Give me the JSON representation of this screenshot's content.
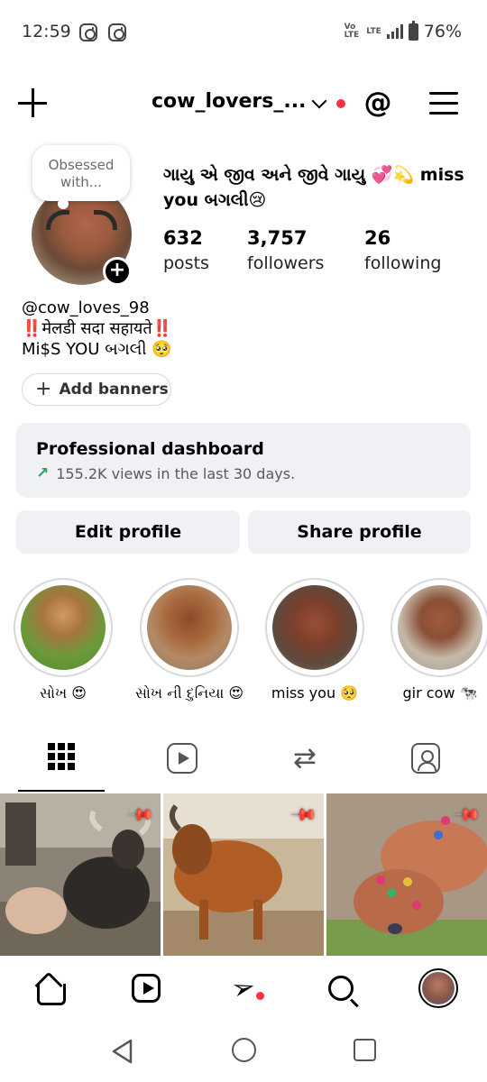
{
  "status_bar": {
    "time": "12:59",
    "network_top": "Vo",
    "network_bottom": "LTE",
    "lte_label": "LTE",
    "battery": "76%"
  },
  "header": {
    "username": "cow_lovers_..."
  },
  "profile": {
    "note": "Obsessed with...",
    "display_name": "ગાયુ એ જીવ અને જીવે ગાયુ 💞💫 miss you બગલી😢",
    "stats": [
      {
        "value": "632",
        "label": "posts"
      },
      {
        "value": "3,757",
        "label": "followers"
      },
      {
        "value": "26",
        "label": "following"
      }
    ],
    "threads_handle": "cow_loves_98",
    "bio_line1": "‼️मेलडी सदा सहायते‼️",
    "bio_line2": " Mi$S YOU બગલી 🥺",
    "add_banners": "Add banners"
  },
  "dashboard": {
    "title": "Professional dashboard",
    "subtitle": "155.2K views in the last 30 days."
  },
  "buttons": {
    "edit": "Edit profile",
    "share": "Share profile"
  },
  "highlights": [
    {
      "label": "સોખ 😍"
    },
    {
      "label": "સોખ ની દુનિયા 😍"
    },
    {
      "label": "miss you 🥺"
    },
    {
      "label": "gir cow 🐄"
    }
  ],
  "colors": {
    "accent_red": "#ff3040",
    "panel_bg": "#eff1f5",
    "trend_green": "#2f9e5e"
  },
  "icons": {
    "tabs": [
      "grid-icon",
      "reels-icon",
      "repost-icon",
      "tagged-icon"
    ],
    "bottom_nav": [
      "home-icon",
      "reels-icon",
      "send-icon",
      "search-icon",
      "profile-avatar"
    ]
  }
}
